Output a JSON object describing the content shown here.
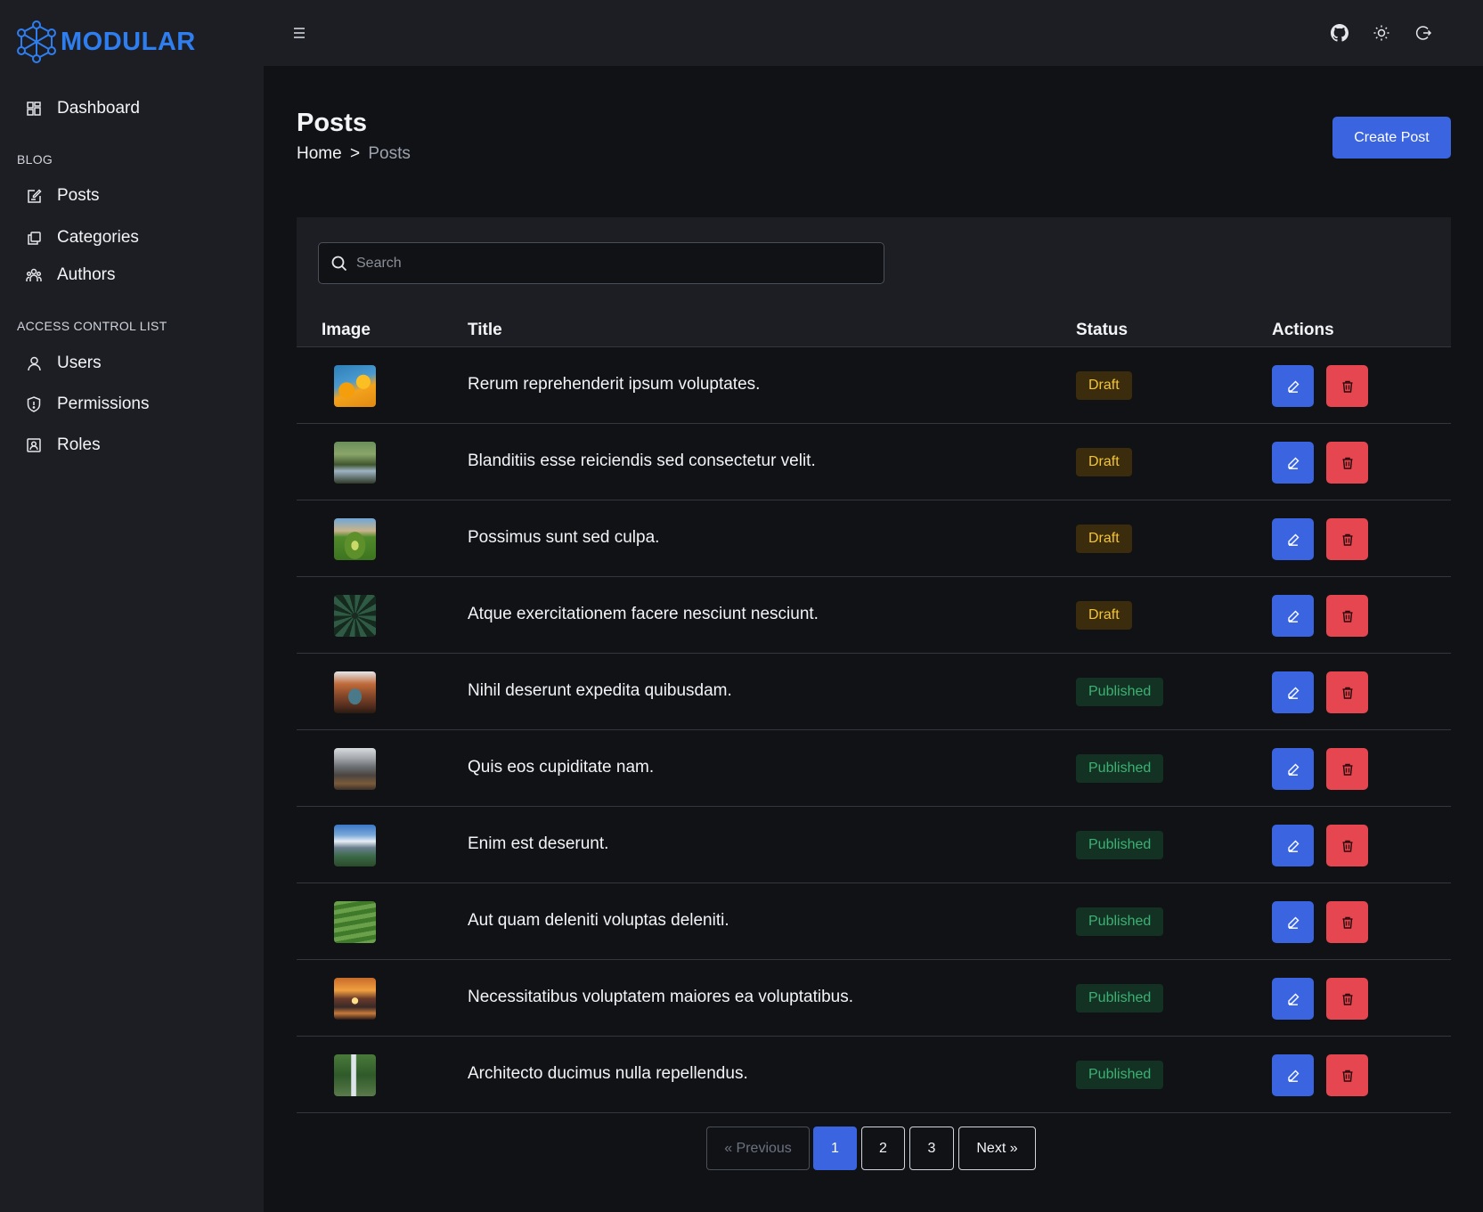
{
  "app": {
    "brand": "MODULAR"
  },
  "sidebar": {
    "dashboard": "Dashboard",
    "section_blog": "BLOG",
    "posts": "Posts",
    "categories": "Categories",
    "authors": "Authors",
    "section_acl": "ACCESS CONTROL LIST",
    "users": "Users",
    "permissions": "Permissions",
    "roles": "Roles"
  },
  "topbar": {
    "icons": [
      "menu-icon",
      "github-icon",
      "sun-icon",
      "logout-icon"
    ]
  },
  "page": {
    "title": "Posts",
    "breadcrumb": {
      "home": "Home",
      "separator": ">",
      "current": "Posts"
    },
    "create_label": "Create Post"
  },
  "search": {
    "placeholder": "Search",
    "value": ""
  },
  "table": {
    "headers": {
      "image": "Image",
      "title": "Title",
      "status": "Status",
      "actions": "Actions"
    },
    "rows": [
      {
        "title": "Rerum reprehenderit ipsum voluptates.",
        "status": "Draft"
      },
      {
        "title": "Blanditiis esse reiciendis sed consectetur velit.",
        "status": "Draft"
      },
      {
        "title": "Possimus sunt sed culpa.",
        "status": "Draft"
      },
      {
        "title": "Atque exercitationem facere nesciunt nesciunt.",
        "status": "Draft"
      },
      {
        "title": "Nihil deserunt expedita quibusdam.",
        "status": "Published"
      },
      {
        "title": "Quis eos cupiditate nam.",
        "status": "Published"
      },
      {
        "title": "Enim est deserunt.",
        "status": "Published"
      },
      {
        "title": "Aut quam deleniti voluptas deleniti.",
        "status": "Published"
      },
      {
        "title": "Necessitatibus voluptatem maiores ea voluptatibus.",
        "status": "Published"
      },
      {
        "title": "Architecto ducimus nulla repellendus.",
        "status": "Published"
      }
    ]
  },
  "pagination": {
    "previous": "« Previous",
    "pages": [
      "1",
      "2",
      "3"
    ],
    "current": "1",
    "next": "Next »"
  },
  "colors": {
    "accent": "#3b64e0",
    "danger": "#e5464f",
    "brand": "#2f7ef0",
    "draft_text": "#f4c431",
    "published_text": "#3bb273"
  }
}
